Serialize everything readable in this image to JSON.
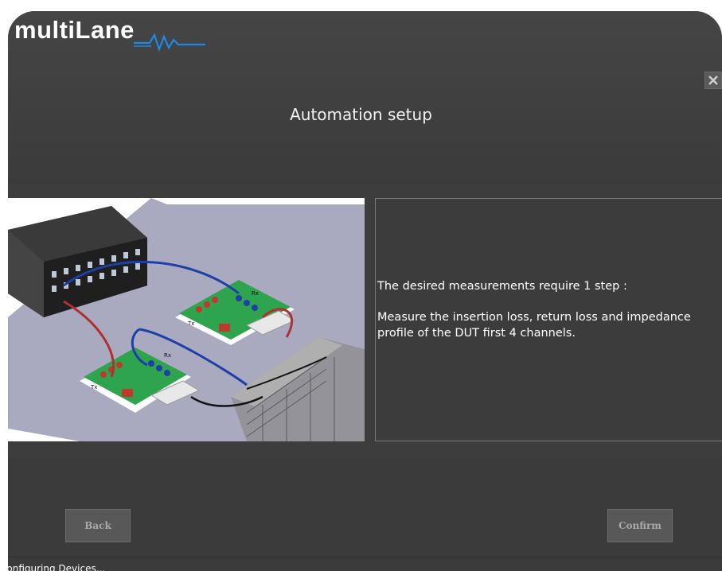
{
  "brand": {
    "logo_text": "multiLane",
    "accent_color": "#1e88e5"
  },
  "window": {
    "title": "Automation setup",
    "close_icon": "close-icon"
  },
  "instructions": {
    "line1": "The desired measurements require 1 step :",
    "line2": "Measure the insertion loss, return loss and impedance profile of the DUT first 4 channels."
  },
  "diagram": {
    "labels": [
      "Tx",
      "Rx",
      "Tx",
      "Rx"
    ]
  },
  "buttons": {
    "back_label": "Back",
    "confirm_label": "Confirm"
  },
  "status": {
    "text": "Configuring Devices..."
  }
}
